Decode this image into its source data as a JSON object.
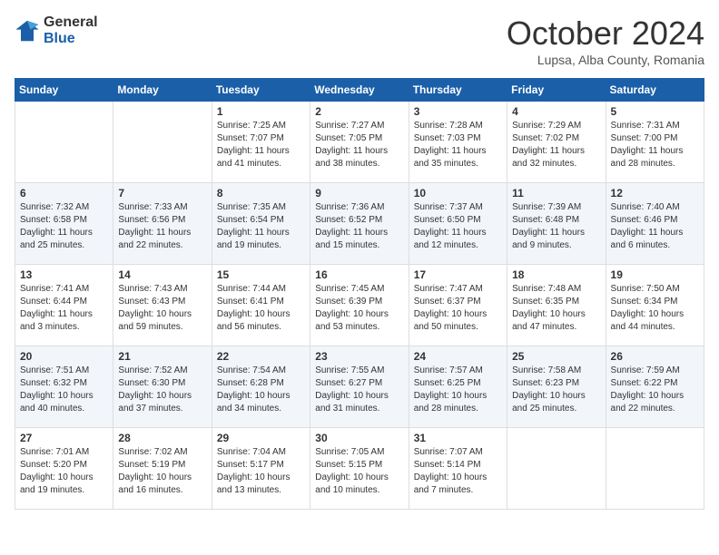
{
  "header": {
    "logo_line1": "General",
    "logo_line2": "Blue",
    "month": "October 2024",
    "location": "Lupsa, Alba County, Romania"
  },
  "weekdays": [
    "Sunday",
    "Monday",
    "Tuesday",
    "Wednesday",
    "Thursday",
    "Friday",
    "Saturday"
  ],
  "weeks": [
    [
      {
        "day": "",
        "info": ""
      },
      {
        "day": "",
        "info": ""
      },
      {
        "day": "1",
        "info": "Sunrise: 7:25 AM\nSunset: 7:07 PM\nDaylight: 11 hours and 41 minutes."
      },
      {
        "day": "2",
        "info": "Sunrise: 7:27 AM\nSunset: 7:05 PM\nDaylight: 11 hours and 38 minutes."
      },
      {
        "day": "3",
        "info": "Sunrise: 7:28 AM\nSunset: 7:03 PM\nDaylight: 11 hours and 35 minutes."
      },
      {
        "day": "4",
        "info": "Sunrise: 7:29 AM\nSunset: 7:02 PM\nDaylight: 11 hours and 32 minutes."
      },
      {
        "day": "5",
        "info": "Sunrise: 7:31 AM\nSunset: 7:00 PM\nDaylight: 11 hours and 28 minutes."
      }
    ],
    [
      {
        "day": "6",
        "info": "Sunrise: 7:32 AM\nSunset: 6:58 PM\nDaylight: 11 hours and 25 minutes."
      },
      {
        "day": "7",
        "info": "Sunrise: 7:33 AM\nSunset: 6:56 PM\nDaylight: 11 hours and 22 minutes."
      },
      {
        "day": "8",
        "info": "Sunrise: 7:35 AM\nSunset: 6:54 PM\nDaylight: 11 hours and 19 minutes."
      },
      {
        "day": "9",
        "info": "Sunrise: 7:36 AM\nSunset: 6:52 PM\nDaylight: 11 hours and 15 minutes."
      },
      {
        "day": "10",
        "info": "Sunrise: 7:37 AM\nSunset: 6:50 PM\nDaylight: 11 hours and 12 minutes."
      },
      {
        "day": "11",
        "info": "Sunrise: 7:39 AM\nSunset: 6:48 PM\nDaylight: 11 hours and 9 minutes."
      },
      {
        "day": "12",
        "info": "Sunrise: 7:40 AM\nSunset: 6:46 PM\nDaylight: 11 hours and 6 minutes."
      }
    ],
    [
      {
        "day": "13",
        "info": "Sunrise: 7:41 AM\nSunset: 6:44 PM\nDaylight: 11 hours and 3 minutes."
      },
      {
        "day": "14",
        "info": "Sunrise: 7:43 AM\nSunset: 6:43 PM\nDaylight: 10 hours and 59 minutes."
      },
      {
        "day": "15",
        "info": "Sunrise: 7:44 AM\nSunset: 6:41 PM\nDaylight: 10 hours and 56 minutes."
      },
      {
        "day": "16",
        "info": "Sunrise: 7:45 AM\nSunset: 6:39 PM\nDaylight: 10 hours and 53 minutes."
      },
      {
        "day": "17",
        "info": "Sunrise: 7:47 AM\nSunset: 6:37 PM\nDaylight: 10 hours and 50 minutes."
      },
      {
        "day": "18",
        "info": "Sunrise: 7:48 AM\nSunset: 6:35 PM\nDaylight: 10 hours and 47 minutes."
      },
      {
        "day": "19",
        "info": "Sunrise: 7:50 AM\nSunset: 6:34 PM\nDaylight: 10 hours and 44 minutes."
      }
    ],
    [
      {
        "day": "20",
        "info": "Sunrise: 7:51 AM\nSunset: 6:32 PM\nDaylight: 10 hours and 40 minutes."
      },
      {
        "day": "21",
        "info": "Sunrise: 7:52 AM\nSunset: 6:30 PM\nDaylight: 10 hours and 37 minutes."
      },
      {
        "day": "22",
        "info": "Sunrise: 7:54 AM\nSunset: 6:28 PM\nDaylight: 10 hours and 34 minutes."
      },
      {
        "day": "23",
        "info": "Sunrise: 7:55 AM\nSunset: 6:27 PM\nDaylight: 10 hours and 31 minutes."
      },
      {
        "day": "24",
        "info": "Sunrise: 7:57 AM\nSunset: 6:25 PM\nDaylight: 10 hours and 28 minutes."
      },
      {
        "day": "25",
        "info": "Sunrise: 7:58 AM\nSunset: 6:23 PM\nDaylight: 10 hours and 25 minutes."
      },
      {
        "day": "26",
        "info": "Sunrise: 7:59 AM\nSunset: 6:22 PM\nDaylight: 10 hours and 22 minutes."
      }
    ],
    [
      {
        "day": "27",
        "info": "Sunrise: 7:01 AM\nSunset: 5:20 PM\nDaylight: 10 hours and 19 minutes."
      },
      {
        "day": "28",
        "info": "Sunrise: 7:02 AM\nSunset: 5:19 PM\nDaylight: 10 hours and 16 minutes."
      },
      {
        "day": "29",
        "info": "Sunrise: 7:04 AM\nSunset: 5:17 PM\nDaylight: 10 hours and 13 minutes."
      },
      {
        "day": "30",
        "info": "Sunrise: 7:05 AM\nSunset: 5:15 PM\nDaylight: 10 hours and 10 minutes."
      },
      {
        "day": "31",
        "info": "Sunrise: 7:07 AM\nSunset: 5:14 PM\nDaylight: 10 hours and 7 minutes."
      },
      {
        "day": "",
        "info": ""
      },
      {
        "day": "",
        "info": ""
      }
    ]
  ]
}
